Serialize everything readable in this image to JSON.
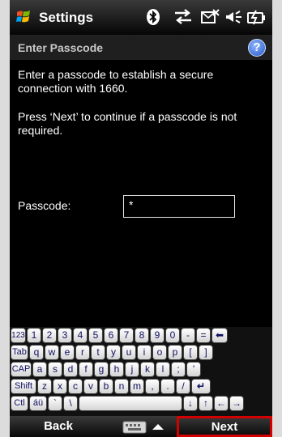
{
  "titlebar": {
    "title": "Settings",
    "status_icons": [
      "bluetooth-icon",
      "connectivity-icon",
      "message-icon",
      "volume-icon",
      "battery-icon"
    ]
  },
  "subheader": {
    "title": "Enter Passcode",
    "help_label": "?"
  },
  "body": {
    "paragraph1": "Enter a passcode to establish a secure connection with 1660.",
    "paragraph2": "Press ‘Next’ to continue if a passcode is not required.",
    "passcode_label": "Passcode:",
    "passcode_value": "*"
  },
  "keyboard": {
    "rows": [
      [
        "123",
        "1",
        "2",
        "3",
        "4",
        "5",
        "6",
        "7",
        "8",
        "9",
        "0",
        "-",
        "=",
        "⬅"
      ],
      [
        "Tab",
        "q",
        "w",
        "e",
        "r",
        "t",
        "y",
        "u",
        "i",
        "o",
        "p",
        "[",
        "]"
      ],
      [
        "CAP",
        "a",
        "s",
        "d",
        "f",
        "g",
        "h",
        "j",
        "k",
        "l",
        ";",
        "'"
      ],
      [
        "Shift",
        "z",
        "x",
        "c",
        "v",
        "b",
        "n",
        "m",
        ",",
        ".",
        "/",
        "↵"
      ],
      [
        "Ctl",
        "áü",
        "`",
        "\\",
        "",
        "↓",
        "↑",
        "←",
        "→"
      ]
    ]
  },
  "softkeys": {
    "left": "Back",
    "right": "Next"
  },
  "colors": {
    "highlight": "#d40000",
    "key_text": "#101060"
  }
}
